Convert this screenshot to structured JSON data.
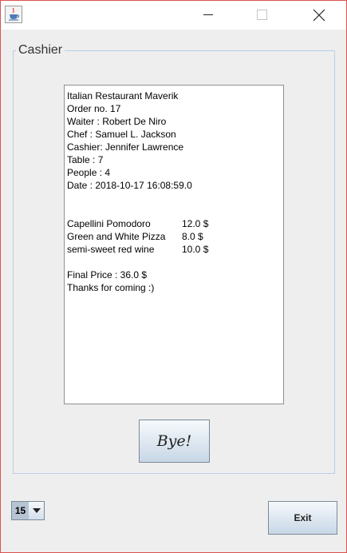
{
  "window": {
    "icon": "java-cup-icon",
    "controls": {
      "minimize": "minimize-icon",
      "maximize": "maximize-icon",
      "close": "close-icon"
    }
  },
  "panel": {
    "title": "Cashier"
  },
  "receipt": {
    "header_lines": [
      "Italian Restaurant Maverik",
      "Order no. 17",
      "Waiter : Robert De Niro",
      "Chef : Samuel L. Jackson",
      "Cashier: Jennifer Lawrence",
      "Table : 7",
      "People : 4",
      "Date : 2018-10-17 16:08:59.0"
    ],
    "items": [
      {
        "name": "Capellini Pomodoro",
        "price": "12.0 $"
      },
      {
        "name": "Green and White Pizza",
        "price": "8.0 $"
      },
      {
        "name": "semi-sweet red wine",
        "price": "10.0 $"
      }
    ],
    "final_price": "Final Price : 36.0 $",
    "thanks": "Thanks for coming :)"
  },
  "buttons": {
    "bye": "Bye!",
    "exit": "Exit"
  },
  "combo": {
    "value": "15"
  }
}
